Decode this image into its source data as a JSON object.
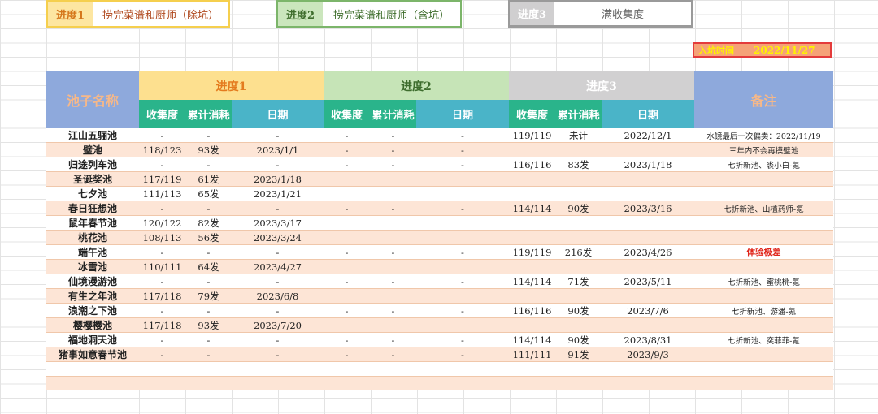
{
  "progress_boxes": [
    {
      "key": "进度1",
      "value": "捞完菜谱和厨师（除坑）"
    },
    {
      "key": "进度2",
      "value": "捞完菜谱和厨师（含坑）"
    },
    {
      "key": "进度3",
      "value": "满收集度"
    }
  ],
  "entry": {
    "label": "入坑时间",
    "date": "2022/11/27"
  },
  "header": {
    "pool": "池子名称",
    "groups": [
      "进度1",
      "进度2",
      "进度3"
    ],
    "notes": "备注",
    "sub": [
      "收集度",
      "累计消耗",
      "日期"
    ]
  },
  "rows": [
    {
      "name": "江山五骊池",
      "c1": [
        "-",
        "-",
        "-"
      ],
      "c2": [
        "-",
        "-",
        "-"
      ],
      "c3": [
        "119/119",
        "未计",
        "2022/12/1"
      ],
      "note": "水镜最后一次偏卖：2022/11/19",
      "red": false
    },
    {
      "name": "璧池",
      "c1": [
        "118/123",
        "93发",
        "2023/1/1"
      ],
      "c2": [
        "-",
        "-",
        "-"
      ],
      "c3": [
        "",
        "",
        ""
      ],
      "note": "三年内不会再摸璧池",
      "red": false
    },
    {
      "name": "归途列车池",
      "c1": [
        "-",
        "-",
        "-"
      ],
      "c2": [
        "-",
        "-",
        "-"
      ],
      "c3": [
        "116/116",
        "83发",
        "2023/1/18"
      ],
      "note": "七折新池、裘小白-氪",
      "red": false
    },
    {
      "name": "圣诞奖池",
      "c1": [
        "117/119",
        "61发",
        "2023/1/18"
      ],
      "c2": [
        "",
        "",
        ""
      ],
      "c3": [
        "",
        "",
        ""
      ],
      "note": "",
      "red": false
    },
    {
      "name": "七夕池",
      "c1": [
        "111/113",
        "65发",
        "2023/1/21"
      ],
      "c2": [
        "",
        "",
        ""
      ],
      "c3": [
        "",
        "",
        ""
      ],
      "note": "",
      "red": false
    },
    {
      "name": "春日狂想池",
      "c1": [
        "-",
        "-",
        "-"
      ],
      "c2": [
        "-",
        "-",
        "-"
      ],
      "c3": [
        "114/114",
        "90发",
        "2023/3/16"
      ],
      "note": "七折新池、山植药师-氪",
      "red": false
    },
    {
      "name": "鼠年春节池",
      "c1": [
        "120/122",
        "82发",
        "2023/3/17"
      ],
      "c2": [
        "",
        "",
        ""
      ],
      "c3": [
        "",
        "",
        ""
      ],
      "note": "",
      "red": false
    },
    {
      "name": "桃花池",
      "c1": [
        "108/113",
        "56发",
        "2023/3/24"
      ],
      "c2": [
        "",
        "",
        ""
      ],
      "c3": [
        "",
        "",
        ""
      ],
      "note": "",
      "red": false
    },
    {
      "name": "端午池",
      "c1": [
        "-",
        "-",
        "-"
      ],
      "c2": [
        "-",
        "-",
        "-"
      ],
      "c3": [
        "119/119",
        "216发",
        "2023/4/26"
      ],
      "note": "体验极差",
      "red": true
    },
    {
      "name": "冰雪池",
      "c1": [
        "110/111",
        "64发",
        "2023/4/27"
      ],
      "c2": [
        "",
        "",
        ""
      ],
      "c3": [
        "",
        "",
        ""
      ],
      "note": "",
      "red": false
    },
    {
      "name": "仙境漫游池",
      "c1": [
        "-",
        "-",
        "-"
      ],
      "c2": [
        "-",
        "-",
        "-"
      ],
      "c3": [
        "114/114",
        "71发",
        "2023/5/11"
      ],
      "note": "七折新池、蜜桃桃-氪",
      "red": false
    },
    {
      "name": "有生之年池",
      "c1": [
        "117/118",
        "79发",
        "2023/6/8"
      ],
      "c2": [
        "",
        "",
        ""
      ],
      "c3": [
        "",
        "",
        ""
      ],
      "note": "",
      "red": false
    },
    {
      "name": "浪潮之下池",
      "c1": [
        "-",
        "-",
        "-"
      ],
      "c2": [
        "-",
        "-",
        "-"
      ],
      "c3": [
        "116/116",
        "90发",
        "2023/7/6"
      ],
      "note": "七折新池、游潘-氪",
      "red": false
    },
    {
      "name": "樱樱樱池",
      "c1": [
        "117/118",
        "93发",
        "2023/7/20"
      ],
      "c2": [
        "",
        "",
        ""
      ],
      "c3": [
        "",
        "",
        ""
      ],
      "note": "",
      "red": false
    },
    {
      "name": "福地洞天池",
      "c1": [
        "-",
        "-",
        "-"
      ],
      "c2": [
        "-",
        "-",
        "-"
      ],
      "c3": [
        "114/114",
        "90发",
        "2023/8/31"
      ],
      "note": "七折新池、奕菲菲-氪",
      "red": false
    },
    {
      "name": "猪事如意春节池",
      "c1": [
        "-",
        "-",
        "-"
      ],
      "c2": [
        "-",
        "-",
        "-"
      ],
      "c3": [
        "111/111",
        "91发",
        "2023/9/3"
      ],
      "note": "",
      "red": false
    }
  ]
}
